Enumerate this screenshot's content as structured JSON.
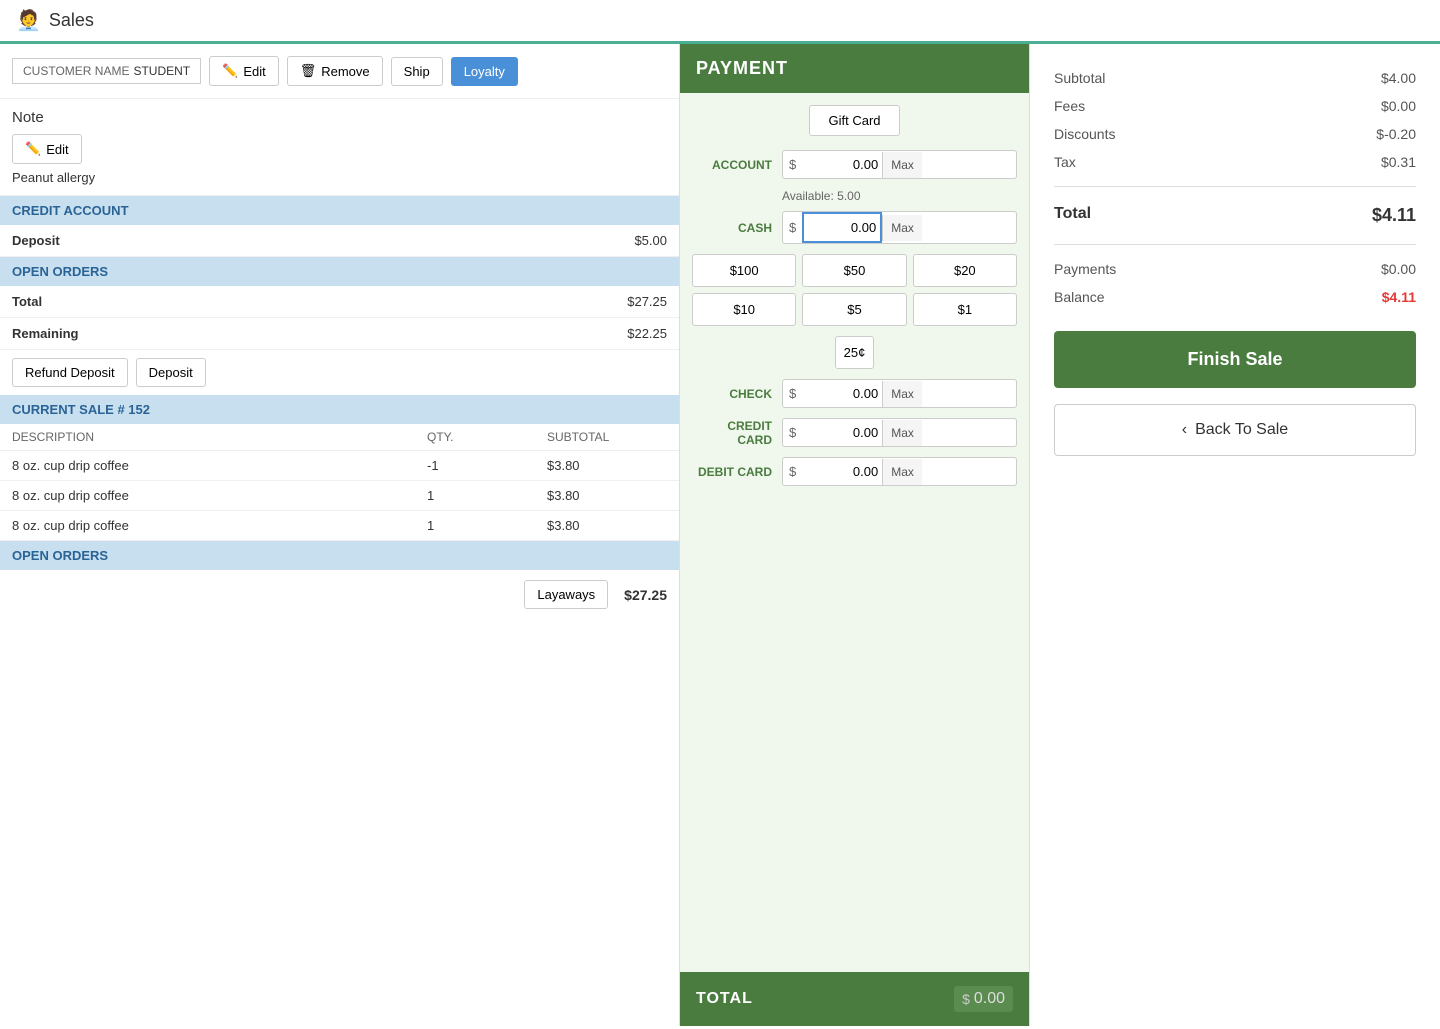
{
  "app": {
    "title": "Sales",
    "icon": "🧑‍💼"
  },
  "customer": {
    "name_label": "CUSTOMER NAME",
    "name_value": "STUDENT",
    "edit_label": "Edit",
    "remove_label": "Remove",
    "ship_label": "Ship",
    "loyalty_label": "Loyalty"
  },
  "note": {
    "title": "Note",
    "edit_label": "Edit",
    "text": "Peanut allergy"
  },
  "credit_account": {
    "header": "CREDIT ACCOUNT",
    "deposit_label": "Deposit",
    "deposit_value": "$5.00"
  },
  "open_orders": {
    "header": "OPEN ORDERS",
    "total_label": "Total",
    "total_value": "$27.25",
    "remaining_label": "Remaining",
    "remaining_value": "$22.25",
    "refund_deposit_label": "Refund Deposit",
    "deposit_label": "Deposit"
  },
  "current_sale": {
    "header": "CURRENT SALE # 152",
    "desc_col": "DESCRIPTION",
    "qty_col": "QTY.",
    "subtotal_col": "SUBTOTAL",
    "items": [
      {
        "description": "8 oz. cup drip coffee",
        "qty": "-1",
        "subtotal": "$3.80"
      },
      {
        "description": "8 oz. cup drip coffee",
        "qty": "1",
        "subtotal": "$3.80"
      },
      {
        "description": "8 oz. cup drip coffee",
        "qty": "1",
        "subtotal": "$3.80"
      }
    ]
  },
  "open_orders_footer": {
    "header": "OPEN ORDERS",
    "layaways_label": "Layaways",
    "total_value": "$27.25"
  },
  "payment": {
    "header": "PAYMENT",
    "gift_card_label": "Gift Card",
    "account_label": "ACCOUNT",
    "account_value": "0.00",
    "account_available": "Available: 5.00",
    "cash_label": "CASH",
    "cash_value": "0.00",
    "cash_buttons": [
      "$100",
      "$50",
      "$20",
      "$10",
      "$5",
      "$1"
    ],
    "cash_cents": "25¢",
    "check_label": "CHECK",
    "check_value": "0.00",
    "credit_card_label": "CREDIT CARD",
    "credit_card_value": "0.00",
    "debit_card_label": "DEBIT CARD",
    "debit_card_value": "0.00",
    "total_label": "TOTAL",
    "total_value": "0.00",
    "max_label": "Max",
    "currency_symbol": "$"
  },
  "summary": {
    "subtotal_label": "Subtotal",
    "subtotal_value": "$4.00",
    "fees_label": "Fees",
    "fees_value": "$0.00",
    "discounts_label": "Discounts",
    "discounts_value": "$-0.20",
    "tax_label": "Tax",
    "tax_value": "$0.31",
    "total_label": "Total",
    "total_value": "$4.11",
    "payments_label": "Payments",
    "payments_value": "$0.00",
    "balance_label": "Balance",
    "balance_value": "$4.11"
  },
  "actions": {
    "finish_sale_label": "Finish Sale",
    "back_to_sale_label": "Back To Sale",
    "back_icon": "‹"
  }
}
